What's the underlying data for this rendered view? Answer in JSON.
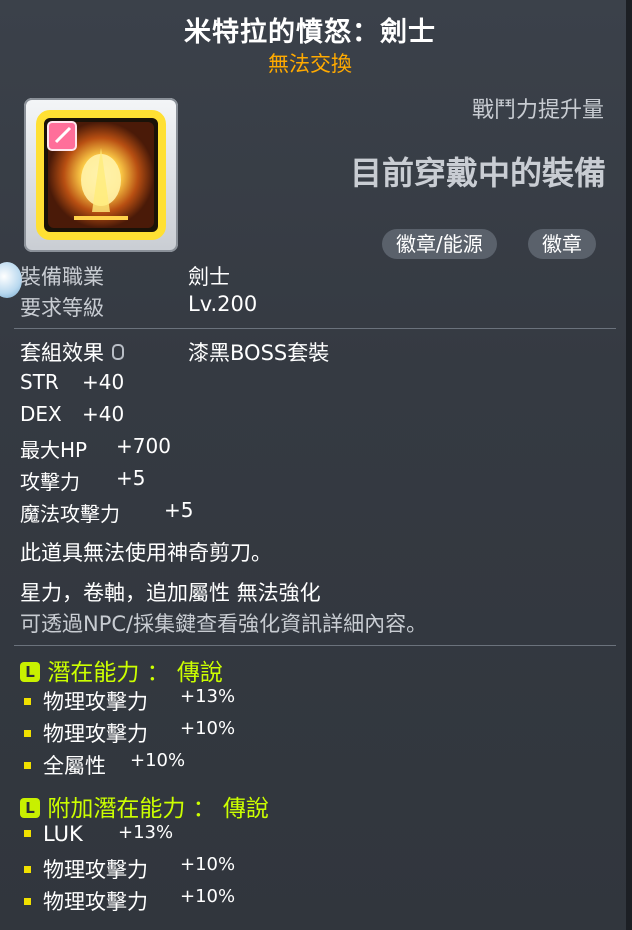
{
  "item": {
    "name": "米特拉的憤怒：劍士",
    "trade_status": "無法交換",
    "icon": "mitra-rage-emblem-icon"
  },
  "header": {
    "combat_power_label": "戰鬥力提升量",
    "equipped_label": "目前穿戴中的裝備",
    "tags": [
      "徽章/能源",
      "徽章"
    ]
  },
  "requirements": {
    "job_label": "裝備職業",
    "job_value": "劍士",
    "level_label": "要求等級",
    "level_value": "Lv.200"
  },
  "set": {
    "label": "套組效果",
    "value": "漆黑BOSS套裝"
  },
  "stats": [
    {
      "name": "STR",
      "value": "+40"
    },
    {
      "name": "DEX",
      "value": "+40"
    },
    {
      "name": "最大HP",
      "value": "+700"
    },
    {
      "name": "攻擊力",
      "value": "+5"
    },
    {
      "name": "魔法攻擊力",
      "value": "+5"
    }
  ],
  "notes": {
    "scissors": "此道具無法使用神奇剪刀。",
    "enhance": "星力，卷軸，追加屬性 無法強化",
    "hint": "可透過NPC/採集鍵查看強化資訊詳細內容。"
  },
  "potential": {
    "badge": "L",
    "title": "潛在能力 ： 傳說",
    "lines": [
      {
        "name": "物理攻擊力",
        "value": "+13%"
      },
      {
        "name": "物理攻擊力",
        "value": "+10%"
      },
      {
        "name": "全屬性",
        "value": "+10%"
      }
    ]
  },
  "bonus_potential": {
    "badge": "L",
    "title": "附加潛在能力 ： 傳說",
    "lines": [
      {
        "name": "LUK",
        "value": "+13%"
      },
      {
        "name": "物理攻擊力",
        "value": "+10%"
      },
      {
        "name": "物理攻擊力",
        "value": "+10%"
      }
    ]
  },
  "colors": {
    "title": "#ffffff",
    "trade": "#ffaa00",
    "potential": "#ccff00",
    "bullet": "#f0e000"
  }
}
